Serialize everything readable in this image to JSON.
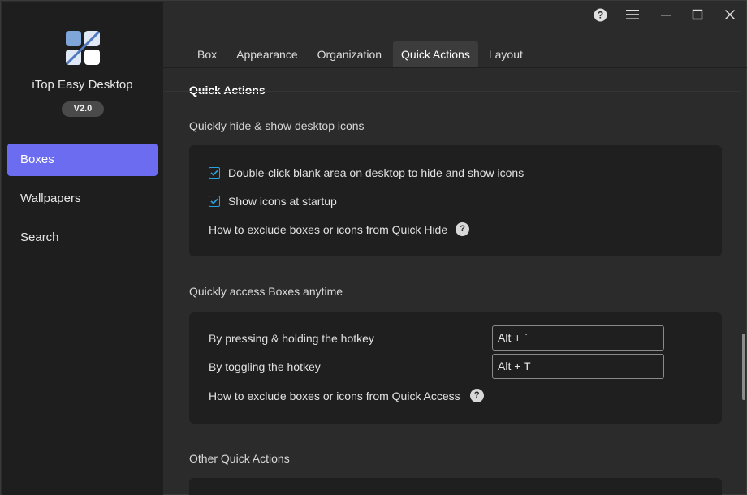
{
  "app": {
    "name": "iTop Easy Desktop",
    "version": "V2.0"
  },
  "sidebar": {
    "items": [
      {
        "label": "Boxes",
        "active": true
      },
      {
        "label": "Wallpapers",
        "active": false
      },
      {
        "label": "Search",
        "active": false
      }
    ]
  },
  "window_controls": [
    "help-icon",
    "menu-icon",
    "minimize-icon",
    "maximize-icon",
    "close-icon"
  ],
  "tabs": [
    {
      "label": "Box",
      "active": false
    },
    {
      "label": "Appearance",
      "active": false
    },
    {
      "label": "Organization",
      "active": false
    },
    {
      "label": "Quick Actions",
      "active": true
    },
    {
      "label": "Layout",
      "active": false
    }
  ],
  "section": {
    "title": "Quick Actions"
  },
  "quick_hide": {
    "subtitle": "Quickly hide & show desktop icons",
    "double_click_label": "Double-click blank area on desktop to hide and show icons",
    "double_click_checked": true,
    "startup_label": "Show icons at startup",
    "startup_checked": true,
    "exclude_label": "How to exclude boxes or icons from Quick Hide"
  },
  "quick_access": {
    "subtitle": "Quickly access Boxes anytime",
    "hold_label": "By pressing & holding the hotkey",
    "hold_value": "Alt + `",
    "toggle_label": "By toggling the hotkey",
    "toggle_value": "Alt + T",
    "exclude_label": "How to exclude boxes or icons from Quick Access"
  },
  "other": {
    "subtitle": "Other Quick Actions"
  },
  "help_glyph": "?",
  "colors": {
    "accent": "#6b6cf0",
    "checkbox": "#29a3e0",
    "sidebar_bg": "#1e1e1e",
    "content_bg": "#2b2b2b",
    "panel_bg": "#1f1f1f"
  }
}
